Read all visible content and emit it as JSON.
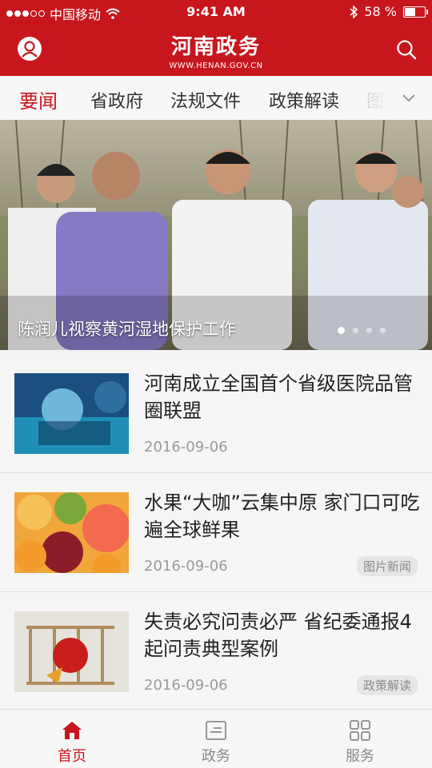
{
  "status_bar": {
    "carrier": "中国移动",
    "time": "9:41 AM",
    "battery": "58 %",
    "battery_level": 0.58
  },
  "header": {
    "title_cn": "河南政务",
    "title_en": "WWW.HENAN.GOV.CN",
    "profile_icon": "user-icon",
    "search_icon": "search-icon"
  },
  "tabs": [
    {
      "label": "要闻",
      "active": true
    },
    {
      "label": "省政府"
    },
    {
      "label": "法规文件"
    },
    {
      "label": "政策解读"
    },
    {
      "label": "图"
    }
  ],
  "hero": {
    "caption": "陈润儿视察黄河湿地保护工作",
    "slide_count": 4,
    "active_slide": 1
  },
  "news": [
    {
      "title": "河南成立全国首个省级医院品管圈联盟",
      "date": "2016-09-06",
      "tag": ""
    },
    {
      "title": "水果“大咖”云集中原 家门口可吃遍全球鲜果",
      "date": "2016-09-06",
      "tag": "图片新闻"
    },
    {
      "title": "失责必究问责必严 省纪委通报4起问责典型案例",
      "date": "2016-09-06",
      "tag": "政策解读"
    }
  ],
  "bottom_nav": [
    {
      "label": "首页",
      "icon": "home-icon",
      "active": true
    },
    {
      "label": "政务",
      "icon": "document-icon"
    },
    {
      "label": "服务",
      "icon": "grid-icon"
    }
  ],
  "colors": {
    "brand": "#c8161d",
    "text": "#222222",
    "muted": "#9a9a9a"
  }
}
